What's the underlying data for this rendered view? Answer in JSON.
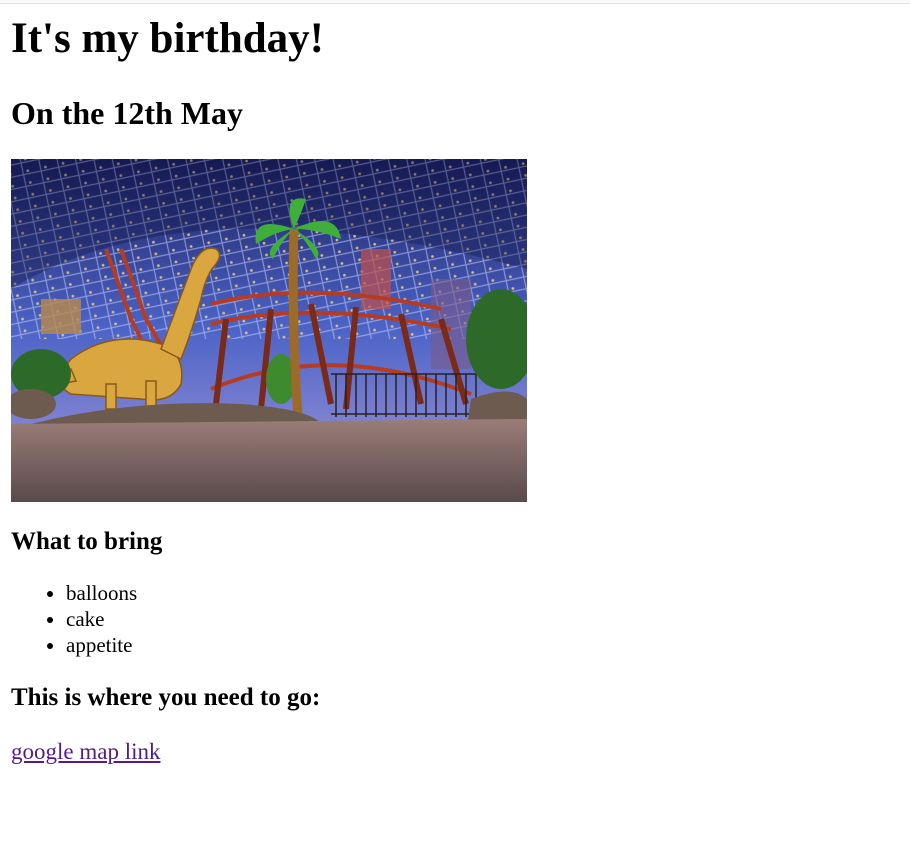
{
  "heading": "It's my birthday!",
  "subheading": "On the 12th May",
  "image": {
    "icon": "theme-park-photo"
  },
  "bring": {
    "title": "What to bring",
    "items": [
      "balloons",
      "cake",
      "appetite"
    ]
  },
  "location": {
    "title": "This is where you need to go:",
    "link_label": "google map link",
    "link_color": "#551a8b"
  }
}
